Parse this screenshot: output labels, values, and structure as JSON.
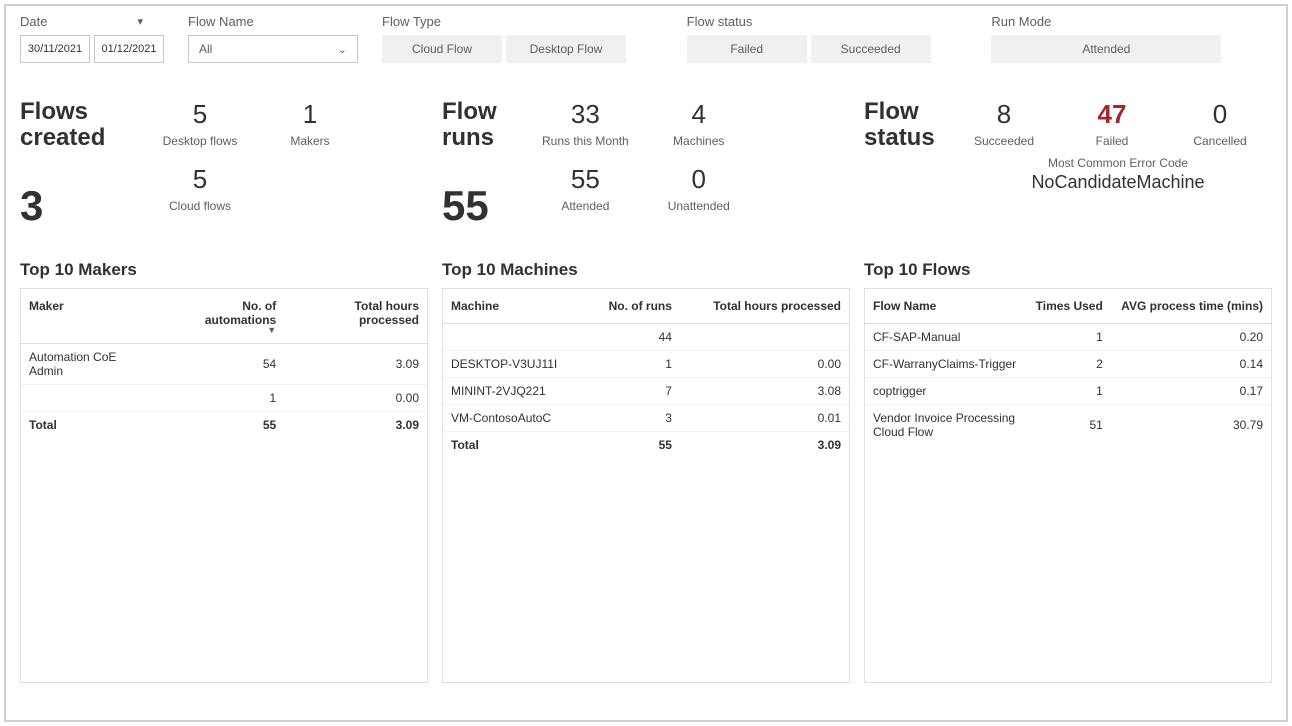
{
  "filters": {
    "date_label": "Date",
    "date_start": "30/11/2021",
    "date_end": "01/12/2021",
    "flow_name_label": "Flow Name",
    "flow_name_value": "All",
    "flow_type_label": "Flow Type",
    "flow_type_options": [
      "Cloud Flow",
      "Desktop Flow"
    ],
    "flow_status_label": "Flow status",
    "flow_status_options": [
      "Failed",
      "Succeeded"
    ],
    "run_mode_label": "Run Mode",
    "run_mode_value": "Attended"
  },
  "cards": {
    "created": {
      "title": "Flows created",
      "big": "3",
      "desktop_flows_value": "5",
      "desktop_flows_label": "Desktop flows",
      "cloud_flows_value": "5",
      "cloud_flows_label": "Cloud flows",
      "makers_value": "1",
      "makers_label": "Makers"
    },
    "runs": {
      "title": "Flow runs",
      "big": "55",
      "runs_month_value": "33",
      "runs_month_label": "Runs this Month",
      "attended_value": "55",
      "attended_label": "Attended",
      "machines_value": "4",
      "machines_label": "Machines",
      "unattended_value": "0",
      "unattended_label": "Unattended"
    },
    "status": {
      "title": "Flow status",
      "succeeded_value": "8",
      "succeeded_label": "Succeeded",
      "failed_value": "47",
      "failed_label": "Failed",
      "cancelled_value": "0",
      "cancelled_label": "Cancelled",
      "err_code_label": "Most Common Error Code",
      "err_code_value": "NoCandidateMachine"
    }
  },
  "tables": {
    "makers": {
      "title": "Top 10 Makers",
      "headers": [
        "Maker",
        "No. of automations",
        "Total hours processed"
      ],
      "rows": [
        {
          "c0": "Automation CoE Admin",
          "c1": "54",
          "c2": "3.09"
        },
        {
          "c0": "",
          "c1": "1",
          "c2": "0.00"
        }
      ],
      "total_label": "Total",
      "total_c1": "55",
      "total_c2": "3.09"
    },
    "machines": {
      "title": "Top 10 Machines",
      "headers": [
        "Machine",
        "No. of runs",
        "Total hours processed"
      ],
      "rows": [
        {
          "c0": "",
          "c1": "44",
          "c2": ""
        },
        {
          "c0": "DESKTOP-V3UJ11I",
          "c1": "1",
          "c2": "0.00"
        },
        {
          "c0": "MININT-2VJQ221",
          "c1": "7",
          "c2": "3.08"
        },
        {
          "c0": "VM-ContosoAutoC",
          "c1": "3",
          "c2": "0.01"
        }
      ],
      "total_label": "Total",
      "total_c1": "55",
      "total_c2": "3.09"
    },
    "flows": {
      "title": "Top 10 Flows",
      "headers": [
        "Flow Name",
        "Times Used",
        "AVG process time (mins)"
      ],
      "rows": [
        {
          "c0": "CF-SAP-Manual",
          "c1": "1",
          "c2": "0.20"
        },
        {
          "c0": "CF-WarranyClaims-Trigger",
          "c1": "2",
          "c2": "0.14"
        },
        {
          "c0": "coptrigger",
          "c1": "1",
          "c2": "0.17"
        },
        {
          "c0": "Vendor Invoice Processing Cloud Flow",
          "c1": "51",
          "c2": "30.79"
        }
      ]
    }
  }
}
